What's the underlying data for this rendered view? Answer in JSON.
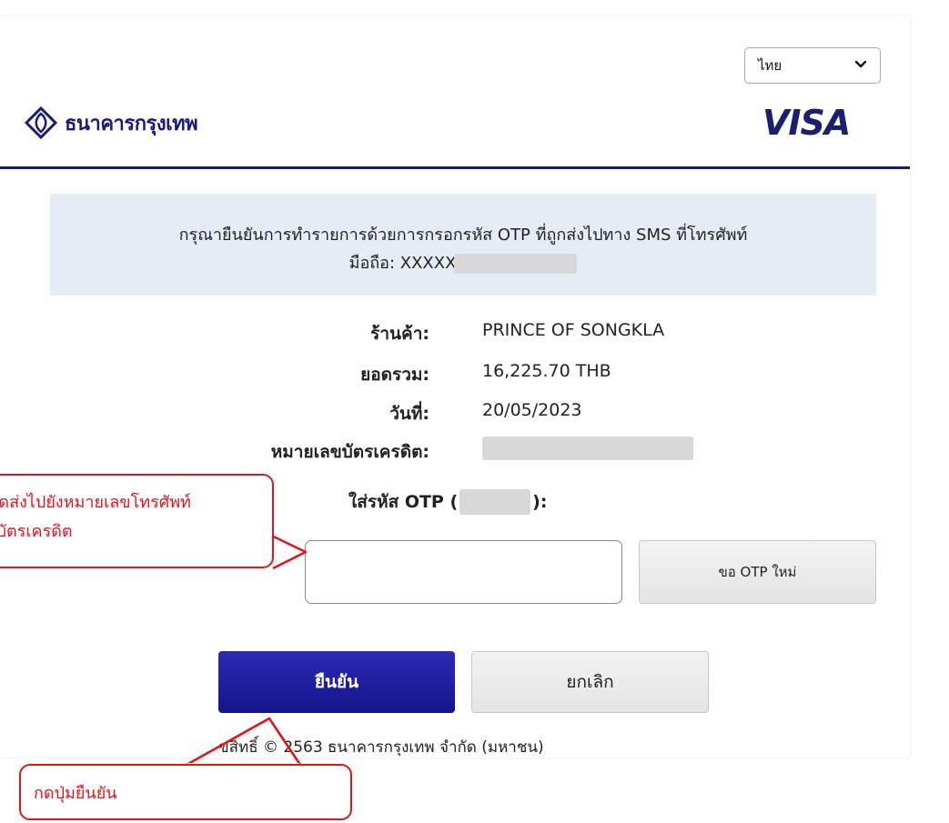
{
  "language_select": {
    "value": "ไทย",
    "icon": "chevron-down-icon"
  },
  "bank_logo": {
    "text": "ธนาคารกรุงเทพ",
    "icon": "bbl-lotus-icon"
  },
  "card_brand": {
    "text": "VISA"
  },
  "colors": {
    "primary": "#1a1a7c",
    "annotation": "#e0161b",
    "notice_bg": "#e6ecf5"
  },
  "notice": {
    "line1": "กรุณายืนยันการทำรายการด้วยการกรอกรหัส OTP ที่ถูกส่งไปทาง SMS ที่โทรศัพท์",
    "line2_prefix": "มือถือ: XXXXX"
  },
  "details": [
    {
      "label": "ร้านค้า:",
      "value": "PRINCE OF SONGKLA"
    },
    {
      "label": "ยอดรวม:",
      "value": "16,225.70 THB"
    },
    {
      "label": "วันที่:",
      "value": "20/05/2023"
    },
    {
      "label": "หมายเลขบัตรเครดิต:",
      "value": ""
    }
  ],
  "otp": {
    "label_prefix": "ใส่รหัส OTP (",
    "label_suffix": "):",
    "value": "",
    "resend_label": "ขอ OTP ใหม่"
  },
  "actions": {
    "confirm_label": "ยืนยัน",
    "cancel_label": "ยกเลิก"
  },
  "footer": {
    "copyright": "ขสิทธิ์ © 2563 ธนาคารกรุงเทพ จำกัด (มหาชน)"
  },
  "annotations": {
    "otp_line1": "ที่จัดส่งไปยังหมายเลขโทรศัพท์",
    "otp_line2": "องบัตรเครดิต",
    "confirm_text": "กดปุ่มยืนยัน"
  }
}
